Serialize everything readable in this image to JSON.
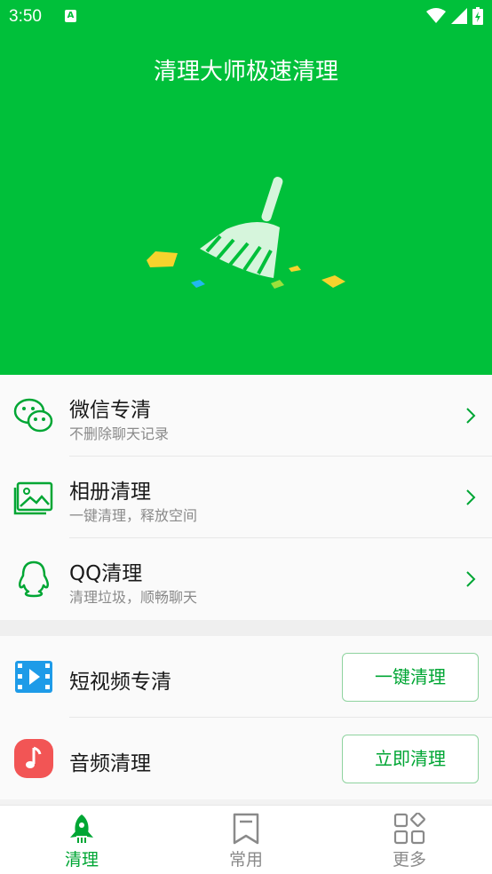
{
  "status": {
    "time": "3:50"
  },
  "hero": {
    "title": "清理大师极速清理"
  },
  "features": [
    {
      "title": "微信专清",
      "subtitle": "不删除聊天记录"
    },
    {
      "title": "相册清理",
      "subtitle": "一键清理，释放空间"
    },
    {
      "title": "QQ清理",
      "subtitle": "清理垃圾，顺畅聊天"
    }
  ],
  "actions": [
    {
      "title": "短视频专清",
      "button": "一键清理"
    },
    {
      "title": "音频清理",
      "button": "立即清理"
    }
  ],
  "tabs": [
    {
      "label": "清理"
    },
    {
      "label": "常用"
    },
    {
      "label": "更多"
    }
  ],
  "colors": {
    "brand": "#00c03a",
    "button_text": "#00a634"
  },
  "icons": [
    "wechat-icon",
    "album-icon",
    "qq-icon",
    "video-icon",
    "music-icon",
    "broom-icon",
    "rocket-icon",
    "bookmark-icon",
    "apps-icon"
  ]
}
